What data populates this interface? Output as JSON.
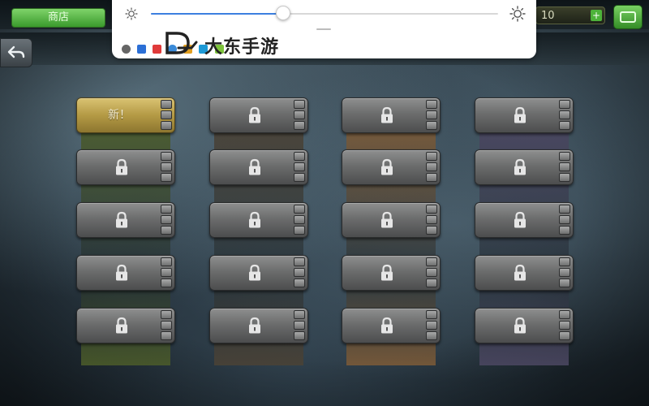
{
  "header": {
    "shop_label": "商店",
    "currency_value": "10",
    "currency_add_label": "+",
    "back_icon": "back-arrow-icon",
    "menu_icon": "menu-icon",
    "stage_title": ""
  },
  "brightness_overlay": {
    "brightness_level": 0.38,
    "small_icon": "sun-dim-icon",
    "large_icon": "sun-bright-icon",
    "watermark_text": "大东手游"
  },
  "level_select": {
    "columns": [
      {
        "art_color": "#4a5a2a",
        "tiles": [
          {
            "state": "new",
            "label": "新！",
            "stars": 0
          },
          {
            "state": "locked",
            "label": "",
            "stars": 0
          },
          {
            "state": "locked",
            "label": "",
            "stars": 0
          },
          {
            "state": "locked",
            "label": "",
            "stars": 0
          },
          {
            "state": "locked",
            "label": "",
            "stars": 0
          }
        ]
      },
      {
        "art_color": "#4a4236",
        "tiles": [
          {
            "state": "locked",
            "label": "",
            "stars": 0
          },
          {
            "state": "locked",
            "label": "",
            "stars": 0
          },
          {
            "state": "locked",
            "label": "",
            "stars": 0
          },
          {
            "state": "locked",
            "label": "",
            "stars": 0
          },
          {
            "state": "locked",
            "label": "",
            "stars": 0
          }
        ]
      },
      {
        "art_color": "#7a5a38",
        "tiles": [
          {
            "state": "locked",
            "label": "",
            "stars": 0
          },
          {
            "state": "locked",
            "label": "",
            "stars": 0
          },
          {
            "state": "locked",
            "label": "",
            "stars": 0
          },
          {
            "state": "locked",
            "label": "",
            "stars": 0
          },
          {
            "state": "locked",
            "label": "",
            "stars": 0
          }
        ]
      },
      {
        "art_color": "#4a4660",
        "tiles": [
          {
            "state": "locked",
            "label": "",
            "stars": 0
          },
          {
            "state": "locked",
            "label": "",
            "stars": 0
          },
          {
            "state": "locked",
            "label": "",
            "stars": 0
          },
          {
            "state": "locked",
            "label": "",
            "stars": 0
          },
          {
            "state": "locked",
            "label": "",
            "stars": 0
          }
        ]
      }
    ],
    "lock_icon": "padlock-icon"
  }
}
